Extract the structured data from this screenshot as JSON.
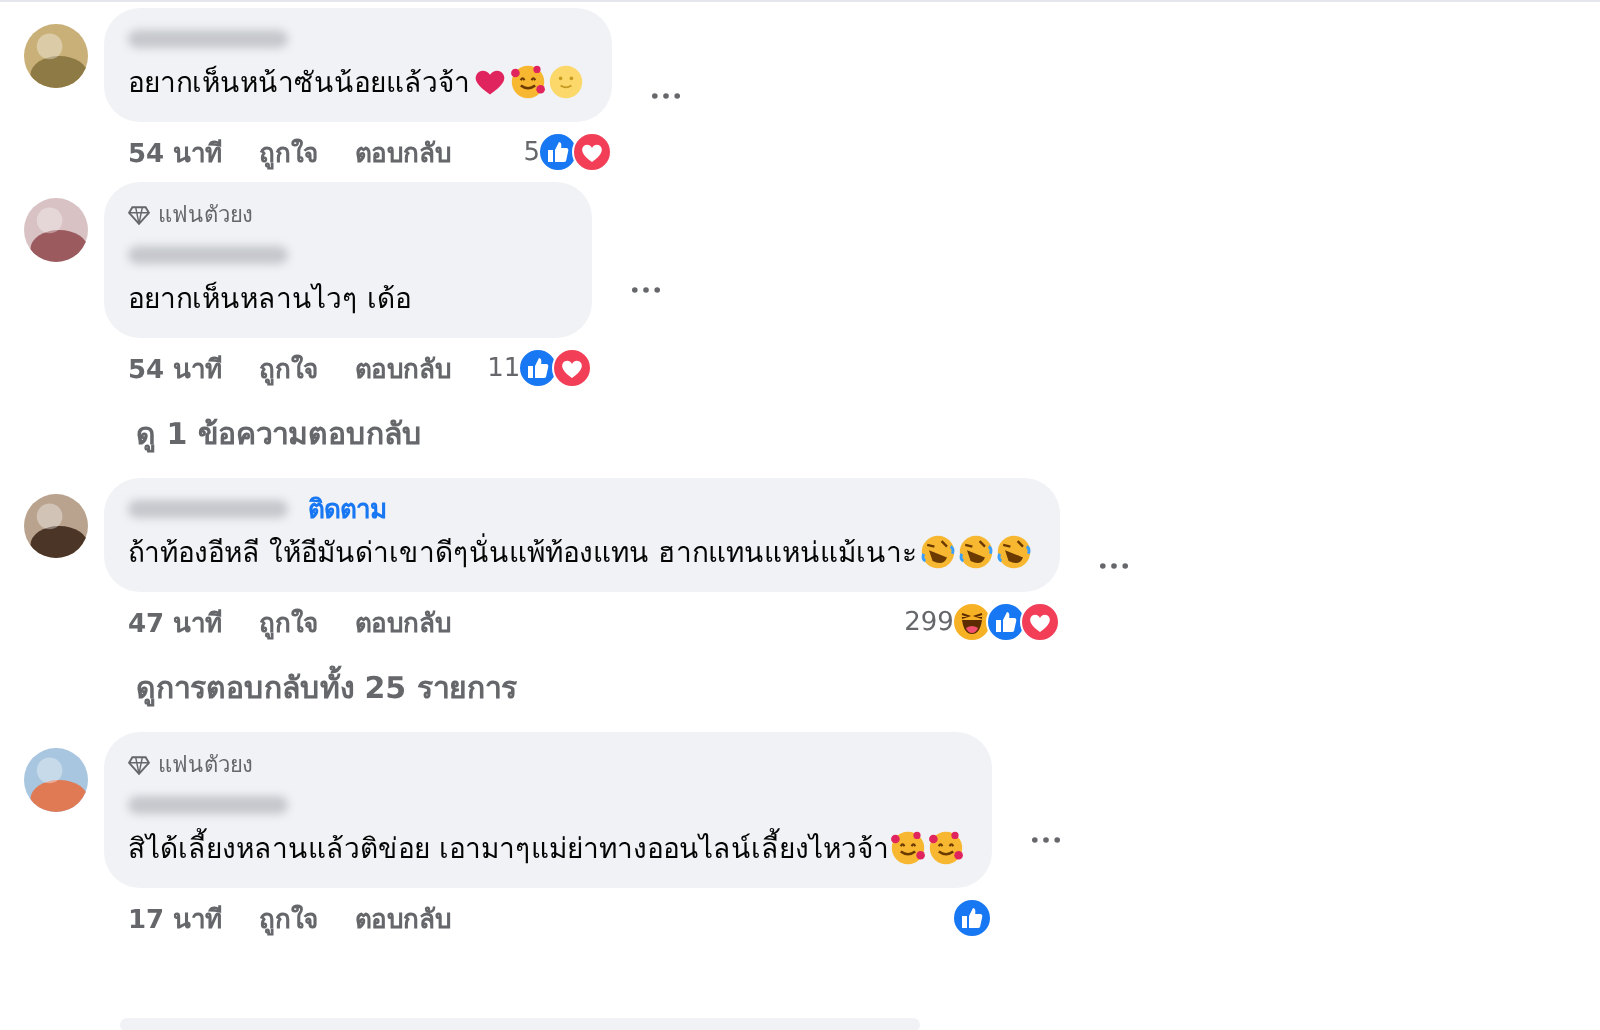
{
  "items": [
    {
      "kind": "comment",
      "name_hidden": true,
      "text": "อยากเห็นหน้าซันน้อยแล้วจ้า",
      "emojis": [
        {
          "kind": "heart"
        },
        {
          "kind": "smiling-hearts"
        },
        {
          "kind": "smile"
        }
      ],
      "time": "54 นาที",
      "like": "ถูกใจ",
      "reply": "ตอบกลับ",
      "reaction_count": "5",
      "reactions": [
        {
          "kind": "like"
        },
        {
          "kind": "love"
        }
      ]
    },
    {
      "kind": "comment",
      "badge": "แฟนตัวยง",
      "name_hidden": true,
      "text": "อยากเห็นหลานไวๆ เด้อ",
      "time": "54 นาที",
      "like": "ถูกใจ",
      "reply": "ตอบกลับ",
      "reaction_count": "11",
      "reactions": [
        {
          "kind": "like"
        },
        {
          "kind": "love"
        }
      ]
    },
    {
      "kind": "replies",
      "text": "ดู 1 ข้อความตอบกลับ"
    },
    {
      "kind": "comment",
      "name_hidden": true,
      "follow": "ติดตาม",
      "text": "ถ้าท้องอีหลี ให้อีมันด่าเขาดีๆนั่นแพ้ท้องแทน ฮากแทนแหน่แม้เนาะ",
      "emojis": [
        {
          "kind": "rofl"
        },
        {
          "kind": "rofl"
        },
        {
          "kind": "rofl"
        }
      ],
      "time": "47 นาที",
      "like": "ถูกใจ",
      "reply": "ตอบกลับ",
      "reaction_count": "299",
      "reactions": [
        {
          "kind": "haha"
        },
        {
          "kind": "like"
        },
        {
          "kind": "love"
        }
      ]
    },
    {
      "kind": "replies",
      "text": "ดูการตอบกลับทั้ง 25 รายการ"
    },
    {
      "kind": "comment",
      "badge": "แฟนตัวยง",
      "name_hidden": true,
      "text": "สิได้เลี้ยงหลานแล้วติข่อย เอามาๆแม่ย่าทางออนไลน์เลี้ยงไหวจ้า",
      "emojis": [
        {
          "kind": "smiling-hearts"
        },
        {
          "kind": "smiling-hearts"
        }
      ],
      "time": "17 นาที",
      "like": "ถูกใจ",
      "reply": "ตอบกลับ",
      "reactions": [
        {
          "kind": "like"
        }
      ]
    }
  ]
}
